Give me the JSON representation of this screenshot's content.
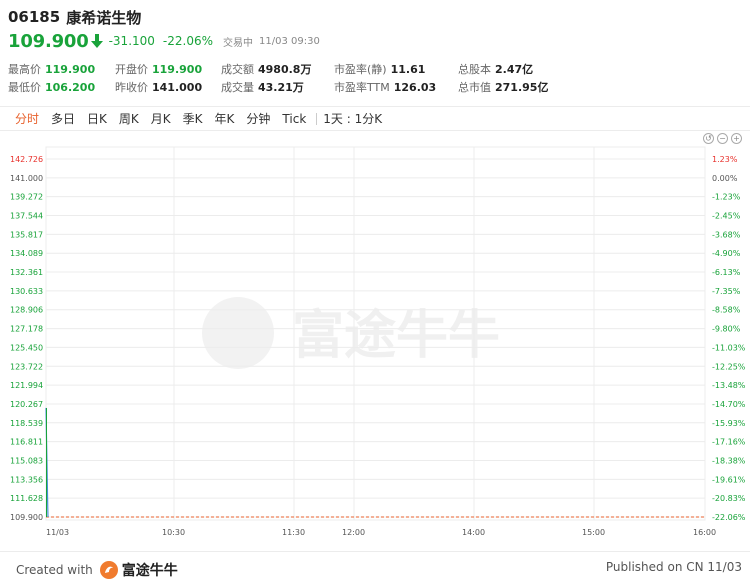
{
  "header": {
    "code": "06185",
    "name": "康希诺生物",
    "price": "109.900",
    "change": "-31.100",
    "change_pct": "-22.06%",
    "status": "交易中",
    "time": "11/03 09:30",
    "arrow": "down-arrow-icon"
  },
  "stats": {
    "row1": [
      {
        "label": "最高价",
        "value": "119.900",
        "color": "green"
      },
      {
        "label": "开盘价",
        "value": "119.900",
        "color": "green"
      },
      {
        "label": "成交额",
        "value": "4980.8万",
        "color": "dark"
      },
      {
        "label": "市盈率(静)",
        "value": "11.61",
        "color": "dark"
      },
      {
        "label": "总股本",
        "value": "2.47亿",
        "color": "dark"
      }
    ],
    "row2": [
      {
        "label": "最低价",
        "value": "106.200",
        "color": "green"
      },
      {
        "label": "昨收价",
        "value": "141.000",
        "color": "dark"
      },
      {
        "label": "成交量",
        "value": "43.21万",
        "color": "dark"
      },
      {
        "label": "市盈率TTM",
        "value": "126.03",
        "color": "dark"
      },
      {
        "label": "总市值",
        "value": "271.95亿",
        "color": "dark"
      }
    ]
  },
  "tabs": [
    "分时",
    "多日",
    "日K",
    "周K",
    "月K",
    "季K",
    "年K",
    "分钟",
    "Tick"
  ],
  "active_tab": "分时",
  "range_label": "1天 : 1分K",
  "chart_data": {
    "type": "line",
    "y_left": [
      "142.726",
      "141.000",
      "139.272",
      "137.544",
      "135.817",
      "134.089",
      "132.361",
      "130.633",
      "128.906",
      "127.178",
      "125.450",
      "123.722",
      "121.994",
      "120.267",
      "118.539",
      "116.811",
      "115.083",
      "113.356",
      "111.628",
      "109.900"
    ],
    "y_right": [
      "1.23%",
      "0.00%",
      "-1.23%",
      "-2.45%",
      "-3.68%",
      "-4.90%",
      "-6.13%",
      "-7.35%",
      "-8.58%",
      "-9.80%",
      "-11.03%",
      "-12.25%",
      "-13.48%",
      "-14.70%",
      "-15.93%",
      "-17.16%",
      "-18.38%",
      "-19.61%",
      "-20.83%",
      "-22.06%"
    ],
    "x_labels": [
      "11/03",
      "10:30",
      "11:30",
      "12:00",
      "14:00",
      "15:00",
      "16:00"
    ],
    "ylim": [
      109.9,
      142.726
    ],
    "prev_close": 141.0,
    "last_price": 109.9,
    "intraday": [
      119.9,
      118.5,
      117.2,
      116.0,
      114.8,
      113.4,
      112.0,
      110.8,
      109.9
    ],
    "colors": {
      "green": "#19a33a",
      "red": "#e8312c",
      "line": "#4a90d9",
      "guide": "#e8612c",
      "grid": "#ececec"
    },
    "watermark": "富途牛牛"
  },
  "footer": {
    "created_with": "Created with",
    "brand": "富途牛牛",
    "published": "Published on CN 11/03"
  }
}
